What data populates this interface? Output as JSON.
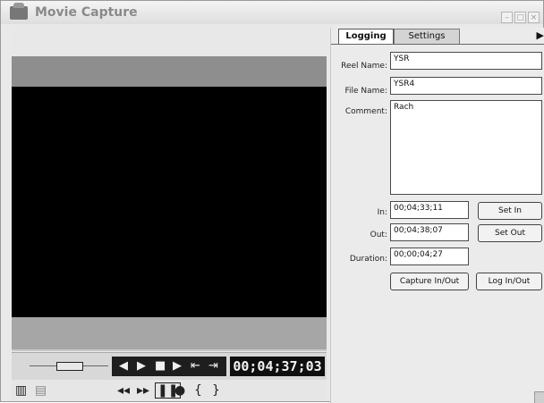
{
  "window": {
    "title": "Movie Capture"
  },
  "tabs": [
    {
      "label": "Logging"
    },
    {
      "label": "Settings"
    }
  ],
  "logging": {
    "reel_name_label": "Reel Name:",
    "reel_name_value": "YSR",
    "file_name_label": "File Name:",
    "file_name_value": "YSR4",
    "comment_label": "Comment:",
    "comment_value": "Rach",
    "in_label": "In:",
    "in_value": "00;04;33;11",
    "set_in_label": "Set In",
    "out_label": "Out:",
    "out_value": "00;04;38;07",
    "set_out_label": "Set Out",
    "duration_label": "Duration:",
    "duration_value": "00;00;04;27",
    "capture_in_out_label": "Capture In/Out",
    "log_in_out_label": "Log In/Out"
  },
  "transport": {
    "timecode": "00;04;37;03",
    "icons": [
      "step-back-icon",
      "play-icon",
      "stop-icon",
      "play-fast-icon",
      "mark-in-icon",
      "mark-out-icon"
    ],
    "lower_icons": [
      "rewind-icon",
      "fast-forward-icon",
      "pause-icon",
      "record-icon",
      "bracket-in-icon",
      "bracket-out-icon"
    ]
  }
}
